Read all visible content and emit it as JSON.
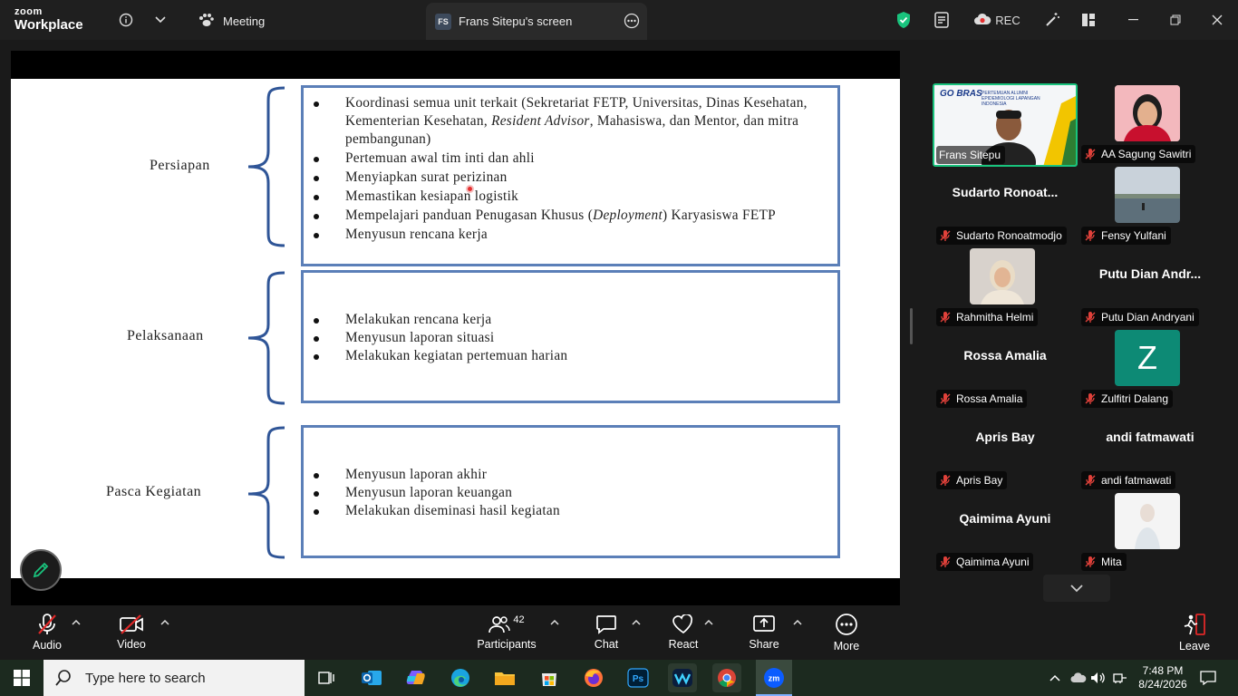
{
  "app": {
    "logo_top": "zoom",
    "logo_bottom": "Workplace"
  },
  "titlebar": {
    "meeting_tab": "Meeting",
    "share_tab_badge": "FS",
    "share_tab_label": "Frans Sitepu's screen",
    "rec_label": "REC"
  },
  "slide": {
    "phases": [
      {
        "label": "Persiapan",
        "items": [
          {
            "text": "Koordinasi semua unit terkait (Sekretariat FETP, Universitas, Dinas Kesehatan, Kementerian Kesehatan, ",
            "italic": "Resident Advisor",
            "tail": ", Mahasiswa, dan Mentor, dan mitra pembangunan)"
          },
          {
            "text": "Pertemuan awal tim inti dan ahli"
          },
          {
            "text": "Menyiapkan surat perizinan"
          },
          {
            "text": "Memastikan kesiapan logistik"
          },
          {
            "text": "Mempelajari panduan Penugasan Khusus (",
            "italic": "Deployment",
            "tail": ") Karyasiswa FETP"
          },
          {
            "text": "Menyusun rencana kerja"
          }
        ]
      },
      {
        "label": "Pelaksanaan",
        "items": [
          {
            "text": "Melakukan rencana kerja"
          },
          {
            "text": "Menyusun laporan situasi"
          },
          {
            "text": "Melakukan kegiatan pertemuan harian"
          }
        ]
      },
      {
        "label": "Pasca Kegiatan",
        "items": [
          {
            "text": "Menyusun laporan akhir"
          },
          {
            "text": "Menyusun laporan keuangan"
          },
          {
            "text": "Melakukan diseminasi hasil kegiatan"
          }
        ]
      }
    ]
  },
  "gallery": {
    "thumb_logo": "GO BRAS",
    "thumb_caption": "PERTEMUAN ALUMNI EPIDEMIOLOGI LAPANGAN INDONESIA",
    "participants": [
      {
        "name": "Frans Sitepu",
        "display": "",
        "muted": false
      },
      {
        "name": "AA Sagung Sawitri",
        "display": "",
        "muted": true
      },
      {
        "name": "Sudarto Ronoatmodjo",
        "display": "Sudarto  Ronoat...",
        "muted": true
      },
      {
        "name": "Fensy Yulfani",
        "display": "",
        "muted": true
      },
      {
        "name": "Rahmitha Helmi",
        "display": "",
        "muted": true
      },
      {
        "name": "Putu Dian Andryani",
        "display": "Putu  Dian  Andr...",
        "muted": true
      },
      {
        "name": "Rossa Amalia",
        "display": "Rossa Amalia",
        "muted": true
      },
      {
        "name": "Zulfitri Dalang",
        "display": "",
        "initial": "Z",
        "muted": true
      },
      {
        "name": "Apris Bay",
        "display": "Apris Bay",
        "muted": true
      },
      {
        "name": "andi fatmawati",
        "display": "andi fatmawati",
        "muted": true
      },
      {
        "name": "Qaimima Ayuni",
        "display": "Qaimima Ayuni",
        "muted": true
      },
      {
        "name": "Mita",
        "display": "",
        "muted": true
      }
    ]
  },
  "toolbar": {
    "audio": "Audio",
    "video": "Video",
    "participants": "Participants",
    "participants_count": "42",
    "chat": "Chat",
    "react": "React",
    "share": "Share",
    "more": "More",
    "leave": "Leave"
  },
  "taskbar": {
    "search_placeholder": "Type here to search",
    "time": "7:48 PM",
    "date": "8/24/2026"
  },
  "colors": {
    "accent_green": "#19c37d",
    "slide_box": "#5b7fb8",
    "leave_red": "#e02828",
    "muted_red": "#e0413a"
  }
}
